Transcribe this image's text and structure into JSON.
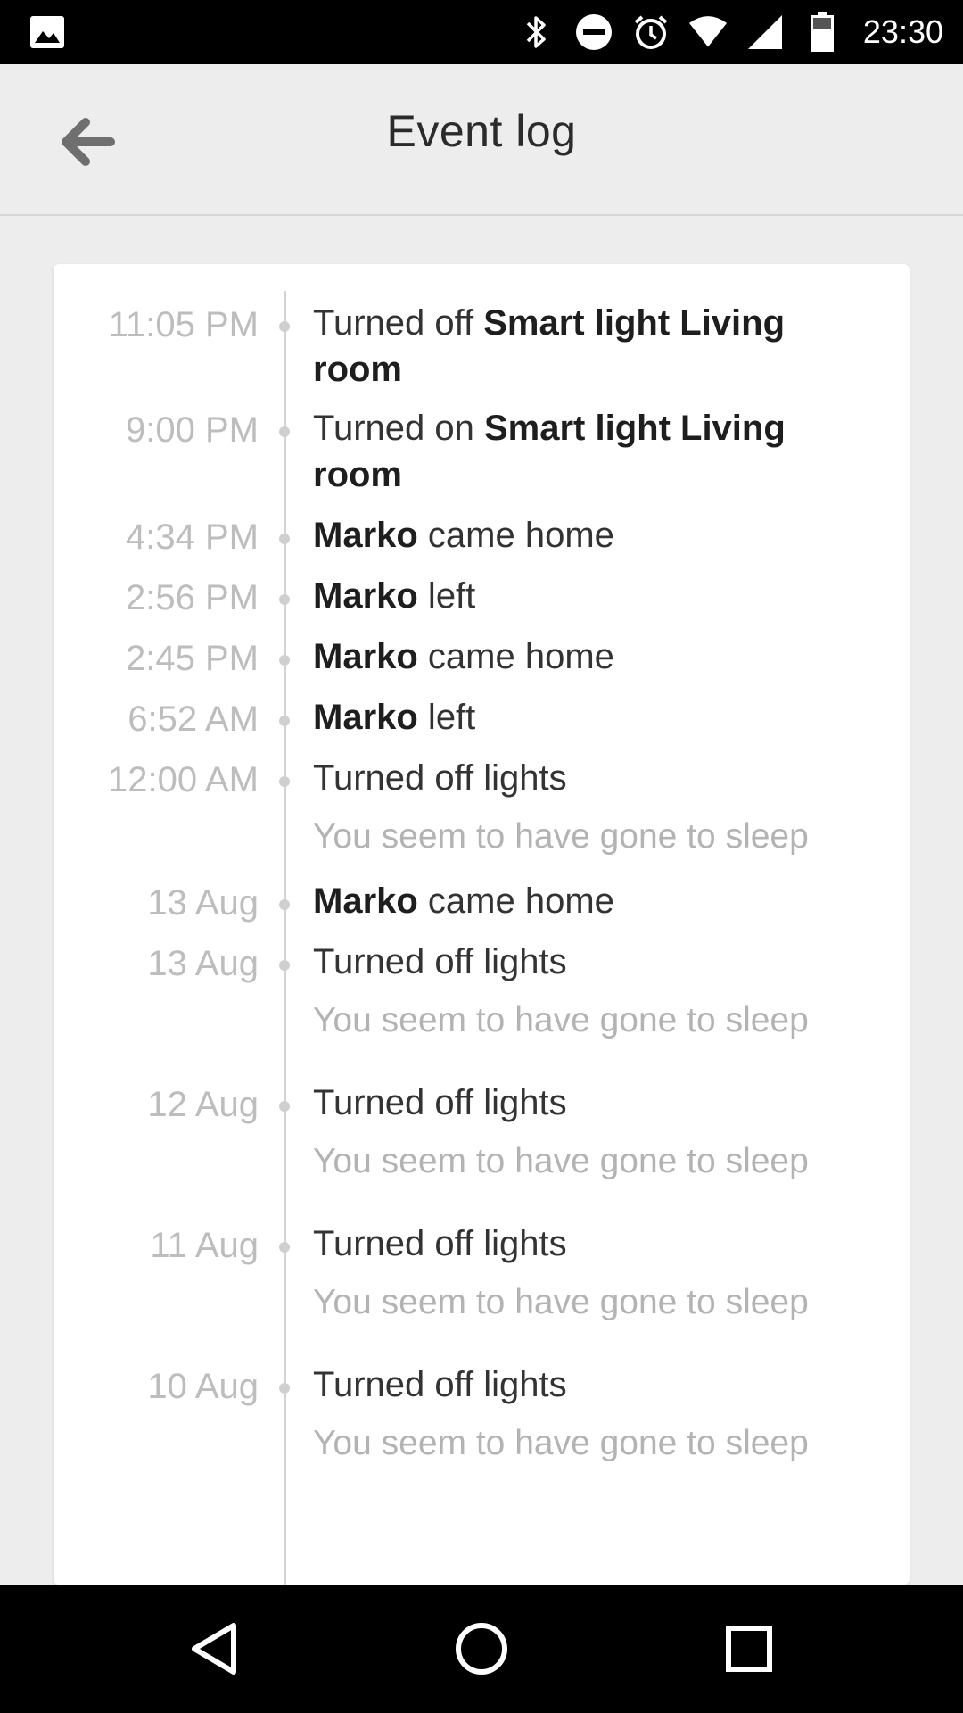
{
  "status_bar": {
    "time": "23:30",
    "icons": [
      "image-icon",
      "bluetooth-icon",
      "do-not-disturb-icon",
      "alarm-icon",
      "wifi-icon",
      "signal-icon",
      "battery-icon"
    ]
  },
  "app_bar": {
    "title": "Event log",
    "back_icon": "arrow-left-icon"
  },
  "events": [
    {
      "time": "11:05 PM",
      "prefix": "Turned off ",
      "bold": "Smart light Living room",
      "suffix": "",
      "sub": ""
    },
    {
      "time": "9:00 PM",
      "prefix": "Turned on ",
      "bold": "Smart light Living room",
      "suffix": "",
      "sub": ""
    },
    {
      "time": "4:34 PM",
      "prefix": "",
      "bold": "Marko",
      "suffix": " came home",
      "sub": ""
    },
    {
      "time": "2:56 PM",
      "prefix": "",
      "bold": "Marko",
      "suffix": " left",
      "sub": ""
    },
    {
      "time": "2:45 PM",
      "prefix": "",
      "bold": "Marko",
      "suffix": " came home",
      "sub": ""
    },
    {
      "time": "6:52 AM",
      "prefix": "",
      "bold": "Marko",
      "suffix": " left",
      "sub": ""
    },
    {
      "time": "12:00 AM",
      "prefix": "Turned off lights",
      "bold": "",
      "suffix": "",
      "sub": "You seem to have gone to sleep"
    },
    {
      "time": "13 Aug",
      "prefix": "",
      "bold": "Marko",
      "suffix": " came home",
      "sub": ""
    },
    {
      "time": "13 Aug",
      "prefix": "Turned off lights",
      "bold": "",
      "suffix": "",
      "sub": "You seem to have gone to sleep"
    },
    {
      "time": "12 Aug",
      "prefix": "Turned off lights",
      "bold": "",
      "suffix": "",
      "sub": "You seem to have gone to sleep"
    },
    {
      "time": "11 Aug",
      "prefix": "Turned off lights",
      "bold": "",
      "suffix": "",
      "sub": "You seem to have gone to sleep"
    },
    {
      "time": "10 Aug",
      "prefix": "Turned off lights",
      "bold": "",
      "suffix": "",
      "sub": "You seem to have gone to sleep"
    }
  ],
  "nav_bar": {
    "icons": [
      "back-triangle-icon",
      "home-circle-icon",
      "recents-square-icon"
    ]
  }
}
